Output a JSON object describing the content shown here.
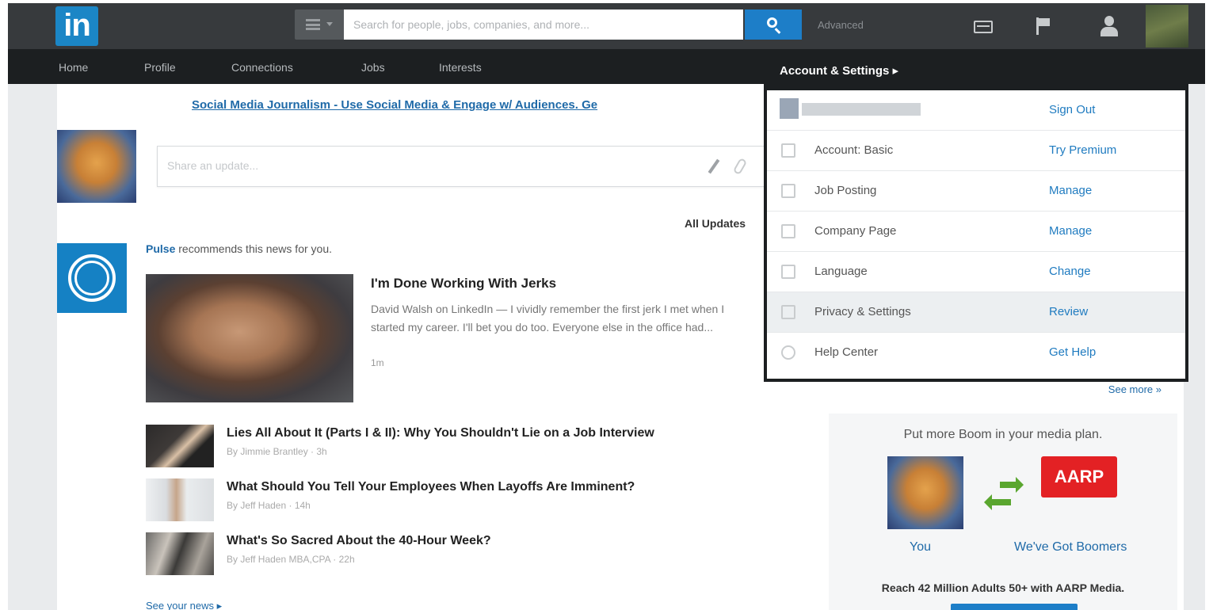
{
  "topbar": {
    "logo": "in",
    "search_placeholder": "Search for people, jobs, companies, and more...",
    "advanced": "Advanced"
  },
  "nav": {
    "items": [
      "Home",
      "Profile",
      "Connections",
      "Jobs",
      "Interests"
    ]
  },
  "main": {
    "ad_banner": "Social Media Journalism - Use Social Media & Engage w/ Audiences. Ge",
    "share_placeholder": "Share an update...",
    "all_updates": "All Updates",
    "pulse_brand": "Pulse",
    "pulse_text": " recommends this news for you.",
    "feature": {
      "title": "I'm Done Working With Jerks",
      "text": "David Walsh on LinkedIn — I vividly remember the first jerk I met when I started my career. I'll bet you do too. Everyone else in the office had...",
      "time": "1m"
    },
    "news": [
      {
        "title": "Lies All About It (Parts I & II): Why You Shouldn't Lie on a Job Interview",
        "meta": "By Jimmie Brantley · 3h"
      },
      {
        "title": "What Should You Tell Your Employees When Layoffs Are Imminent?",
        "meta": "By Jeff Haden · 14h"
      },
      {
        "title": "What's So Sacred About the 40-Hour Week?",
        "meta": "By Jeff Haden MBA,CPA · 22h"
      }
    ],
    "see_news": "See your news ▸"
  },
  "rail": {
    "see_more": "See more »",
    "ad_headline": "Put more Boom in your media plan.",
    "aarp_logo": "AARP",
    "label_you": "You",
    "label_boom": "We've Got Boomers",
    "bottom": "Reach 42 Million Adults 50+ with AARP Media."
  },
  "dropdown": {
    "header": "Account & Settings ▸",
    "rows": [
      {
        "label": "",
        "action": "Sign Out"
      },
      {
        "label": "Account: Basic",
        "action": "Try Premium"
      },
      {
        "label": "Job Posting",
        "action": "Manage"
      },
      {
        "label": "Company Page",
        "action": "Manage"
      },
      {
        "label": "Language",
        "action": "Change"
      },
      {
        "label": "Privacy & Settings",
        "action": "Review"
      },
      {
        "label": "Help Center",
        "action": "Get Help"
      }
    ]
  },
  "colors": {
    "brand": "#1b86c6",
    "link": "#1f6aa8",
    "topbar": "#373a3d",
    "navbar": "#1c1f21"
  }
}
